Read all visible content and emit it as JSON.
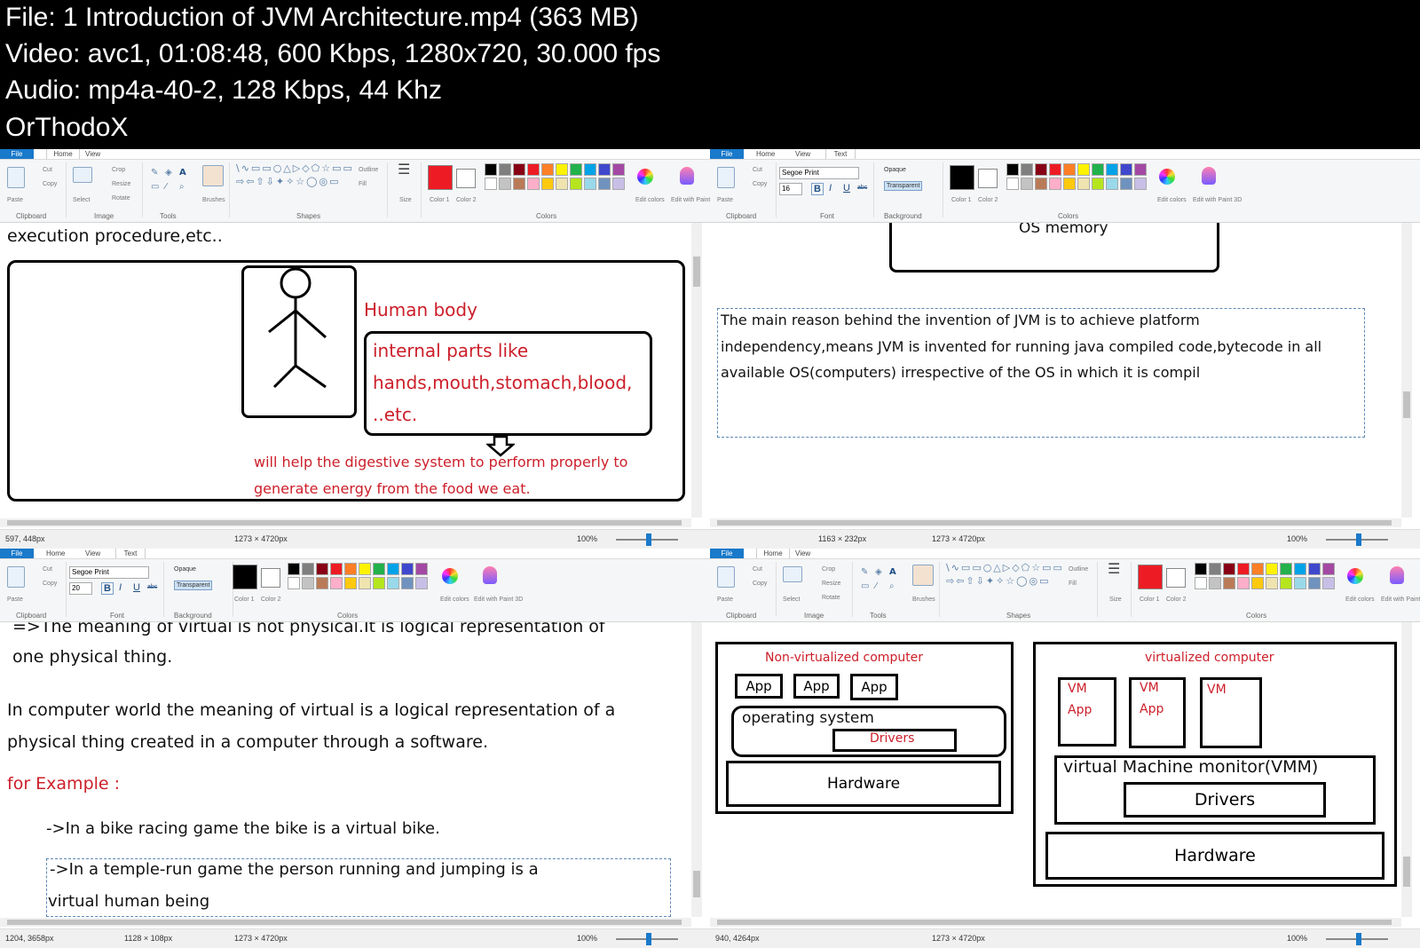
{
  "header": {
    "line1": "File: 1  Introduction of JVM Architecture.mp4 (363 MB)",
    "line2": "Video: avc1, 01:08:48, 600 Kbps, 1280x720, 30.000 fps",
    "line3": "Audio: mp4a-40-2, 128 Kbps, 44 Khz",
    "line4": "OrThodoX"
  },
  "ribbon": {
    "tab_file": "File",
    "tab_home": "Home",
    "tab_view": "View",
    "tab_text": "Text",
    "paste": "Paste",
    "cut": "Cut",
    "copy": "Copy",
    "select": "Select",
    "crop": "Crop",
    "resize": "Resize",
    "rotate": "Rotate",
    "brushes": "Brushes",
    "outline": "Outline",
    "fill": "Fill",
    "size": "Size",
    "color1": "Color 1",
    "color2": "Color 2",
    "edit_colors": "Edit colors",
    "edit_paint3d": "Edit with Paint 3D",
    "opaque": "Opaque",
    "transparent": "Transparent",
    "font_name": "Segoe Print",
    "font_size_a": "16",
    "font_size_b": "20",
    "bold": "B",
    "italic": "I",
    "underline": "U",
    "strike": "abc",
    "g_clipboard": "Clipboard",
    "g_image": "Image",
    "g_tools": "Tools",
    "g_shapes": "Shapes",
    "g_colors": "Colors",
    "g_font": "Font",
    "g_background": "Background"
  },
  "colors": {
    "accent": "#1979ca",
    "palette": [
      "#000000",
      "#7f7f7f",
      "#880015",
      "#ed1c24",
      "#ff7f27",
      "#fff200",
      "#22b14c",
      "#00a2e8",
      "#3f48cc",
      "#a349a4",
      "#ffffff",
      "#c3c3c3",
      "#b97a57",
      "#ffaec9",
      "#ffc90e",
      "#efe4b0",
      "#b5e61d",
      "#99d9ea",
      "#7092be",
      "#c8bfe7"
    ],
    "primary_red": "#ed1c24"
  },
  "pane1": {
    "line_top": "execution procedure,etc..",
    "human_body": "Human body",
    "internal1": "internal parts like",
    "internal2": "hands,mouth,stomach,blood,",
    "internal3": "..etc.",
    "help1": "will help the digestive system to perform properly to",
    "help2": "generate energy from the food we eat.",
    "status_pos": "597, 448px",
    "status_canvas": "1273 × 4720px",
    "zoom": "100%"
  },
  "pane2": {
    "os_memory": "OS memory",
    "text1": "The main reason behind the invention of JVM is to achieve platform",
    "text2": "independency,means JVM is invented for running java compiled code,bytecode in all",
    "text3": "available OS(computers) irrespective of the OS in which it is compil",
    "status_sel": "1163 × 232px",
    "status_canvas": "1273 × 4720px",
    "zoom": "100%"
  },
  "pane3": {
    "line1": "=>The meaning of virtual is not physical.It is logical representation of",
    "line2": "one physical thing.",
    "line3": "In computer world the meaning of virtual is a logical representation of a",
    "line4": "physical thing created in a computer through a software.",
    "example": "for Example :",
    "bike": "->In a bike racing game the bike is a virtual bike.",
    "temple1": "->In a temple-run game the person running and jumping is a",
    "temple2": "virtual human being",
    "status_pos": "1204, 3658px",
    "status_sel": "1128 × 108px",
    "status_canvas": "1273 × 4720px",
    "zoom": "100%"
  },
  "pane4": {
    "nonvirt_title": "Non-virtualized computer",
    "app": "App",
    "os": "operating system",
    "drivers": "Drivers",
    "hardware": "Hardware",
    "virt_title": "virtualized computer",
    "vm": "VM",
    "vmm": "virtual Machine monitor(VMM)",
    "status_pos": "940, 4264px",
    "status_canvas": "1273 × 4720px",
    "zoom": "100%"
  }
}
